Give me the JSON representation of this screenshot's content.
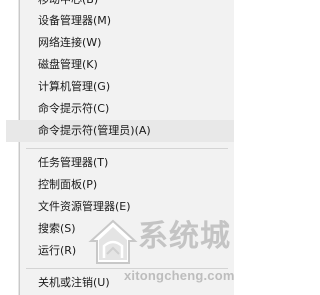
{
  "context_menu": {
    "items": [
      {
        "label": "移动中心(B)"
      },
      {
        "label": "设备管理器(M)"
      },
      {
        "label": "网络连接(W)"
      },
      {
        "label": "磁盘管理(K)"
      },
      {
        "label": "计算机管理(G)"
      },
      {
        "label": "命令提示符(C)"
      },
      {
        "label": "命令提示符(管理员)(A)"
      },
      {
        "label": "任务管理器(T)"
      },
      {
        "label": "控制面板(P)"
      },
      {
        "label": "文件资源管理器(E)"
      },
      {
        "label": "搜索(S)"
      },
      {
        "label": "运行(R)"
      },
      {
        "label": "关机或注销(U)"
      }
    ],
    "hovered_index": 6
  },
  "watermark": {
    "site_name": "系统城",
    "url": "xitongcheng.com",
    "logo_icon": "house-logo-icon"
  },
  "colors": {
    "menu_background": "#f2f2f2",
    "hover_background": "#e8e8e8",
    "text": "#1a1a1a",
    "watermark_gray": "#c4c4c4"
  }
}
